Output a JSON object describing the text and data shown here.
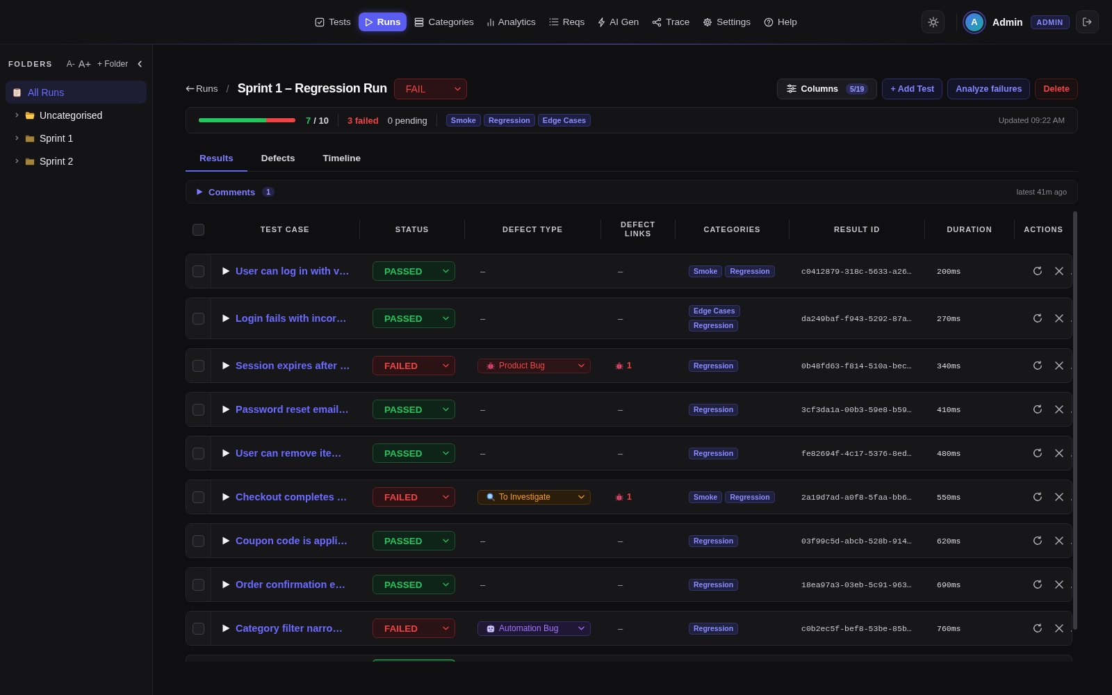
{
  "nav": {
    "items": [
      {
        "label": "Tests",
        "selected": false
      },
      {
        "label": "Runs",
        "selected": true
      },
      {
        "label": "Categories",
        "selected": false
      },
      {
        "label": "Analytics",
        "selected": false
      },
      {
        "label": "Reqs",
        "selected": false
      },
      {
        "label": "AI Gen",
        "selected": false
      },
      {
        "label": "Trace",
        "selected": false
      },
      {
        "label": "Settings",
        "selected": false
      },
      {
        "label": "Help",
        "selected": false
      }
    ]
  },
  "user": {
    "avatar_letter": "A",
    "name": "Admin",
    "role": "ADMIN"
  },
  "sidebar": {
    "title": "FOLDERS",
    "actions": [
      "A-",
      "A+",
      "+ Folder"
    ],
    "all_runs": {
      "label": "All Runs",
      "selected": true
    },
    "folders": [
      {
        "label": "Uncategorised",
        "kind": "uncategorised",
        "expanded": false,
        "selected": false
      },
      {
        "label": "Sprint 1",
        "kind": "folder",
        "expanded": false,
        "selected": false
      },
      {
        "label": "Sprint 2",
        "kind": "folder",
        "expanded": false,
        "selected": false
      }
    ]
  },
  "run": {
    "back_link": "Runs",
    "separator": "/",
    "title": "Sprint 1 – Regression Run",
    "result": {
      "label": "FAIL",
      "kind": "fail"
    },
    "buttons": [
      {
        "label": "Columns",
        "badge": "5/19",
        "kind": "menu"
      },
      {
        "label": "+ Add Test",
        "kind": "accent"
      },
      {
        "label": "Analyze failures",
        "kind": "accent"
      },
      {
        "label": "Delete",
        "kind": "danger"
      }
    ]
  },
  "summary": {
    "progress": {
      "level": 0.7
    },
    "passed": "7",
    "total": "/ 10",
    "failed": "3 failed",
    "pending": "0 pending",
    "tags": [
      "Smoke",
      "Regression",
      "Edge Cases"
    ],
    "updated": "Updated 09:22 AM"
  },
  "tabs": [
    {
      "label": "Results",
      "selected": true
    },
    {
      "label": "Defects",
      "selected": false
    },
    {
      "label": "Timeline",
      "selected": false
    }
  ],
  "comments": {
    "label": "Comments",
    "count": "1",
    "expanded": false,
    "latest": "latest 41m ago"
  },
  "table": {
    "select_all": {
      "checked": false
    },
    "columns": [
      "TEST CASE",
      "STATUS",
      "DEFECT TYPE",
      "DEFECT LINKS",
      "CATEGORIES",
      "RESULT ID",
      "DURATION",
      "ACTIONS"
    ],
    "rows": [
      {
        "checked": false,
        "expanded": false,
        "test_case": "User can log in with v…",
        "status": {
          "label": "PASSED",
          "kind": "passed"
        },
        "defect_type": {
          "kind": "none",
          "text": "–"
        },
        "defect_links": {
          "kind": "none",
          "text": "–"
        },
        "categories": [
          "Smoke",
          "Regression"
        ],
        "result_id": "c0412879-318c-5633-a26…",
        "duration": "200ms"
      },
      {
        "checked": false,
        "expanded": false,
        "test_case": "Login fails with incor…",
        "status": {
          "label": "PASSED",
          "kind": "passed"
        },
        "defect_type": {
          "kind": "none",
          "text": "–"
        },
        "defect_links": {
          "kind": "none",
          "text": "–"
        },
        "categories": [
          "Edge Cases",
          "Regression"
        ],
        "result_id": "da249baf-f943-5292-87a…",
        "duration": "270ms"
      },
      {
        "checked": false,
        "expanded": false,
        "test_case": "Session expires after …",
        "status": {
          "label": "FAILED",
          "kind": "failed"
        },
        "defect_type": {
          "kind": "product_bug",
          "label": "Product Bug"
        },
        "defect_links": {
          "kind": "linked",
          "count": "1"
        },
        "categories": [
          "Regression"
        ],
        "result_id": "0b48fd63-f814-510a-bec…",
        "duration": "340ms"
      },
      {
        "checked": false,
        "expanded": false,
        "test_case": "Password reset email…",
        "status": {
          "label": "PASSED",
          "kind": "passed"
        },
        "defect_type": {
          "kind": "none",
          "text": "–"
        },
        "defect_links": {
          "kind": "none",
          "text": "–"
        },
        "categories": [
          "Regression"
        ],
        "result_id": "3cf3da1a-00b3-59e8-b59…",
        "duration": "410ms"
      },
      {
        "checked": false,
        "expanded": false,
        "test_case": "User can remove ite…",
        "status": {
          "label": "PASSED",
          "kind": "passed"
        },
        "defect_type": {
          "kind": "none",
          "text": "–"
        },
        "defect_links": {
          "kind": "none",
          "text": "–"
        },
        "categories": [
          "Regression"
        ],
        "result_id": "fe82694f-4c17-5376-8ed…",
        "duration": "480ms"
      },
      {
        "checked": false,
        "expanded": false,
        "test_case": "Checkout completes …",
        "status": {
          "label": "FAILED",
          "kind": "failed"
        },
        "defect_type": {
          "kind": "to_investigate",
          "label": "To Investigate"
        },
        "defect_links": {
          "kind": "linked",
          "count": "1"
        },
        "categories": [
          "Smoke",
          "Regression"
        ],
        "result_id": "2a19d7ad-a0f8-5faa-bb6…",
        "duration": "550ms"
      },
      {
        "checked": false,
        "expanded": false,
        "test_case": "Coupon code is appli…",
        "status": {
          "label": "PASSED",
          "kind": "passed"
        },
        "defect_type": {
          "kind": "none",
          "text": "–"
        },
        "defect_links": {
          "kind": "none",
          "text": "–"
        },
        "categories": [
          "Regression"
        ],
        "result_id": "03f99c5d-abcb-528b-914…",
        "duration": "620ms"
      },
      {
        "checked": false,
        "expanded": false,
        "test_case": "Order confirmation e…",
        "status": {
          "label": "PASSED",
          "kind": "passed"
        },
        "defect_type": {
          "kind": "none",
          "text": "–"
        },
        "defect_links": {
          "kind": "none",
          "text": "–"
        },
        "categories": [
          "Regression"
        ],
        "result_id": "18ea97a3-03eb-5c91-963…",
        "duration": "690ms"
      },
      {
        "checked": false,
        "expanded": false,
        "test_case": "Category filter narro…",
        "status": {
          "label": "FAILED",
          "kind": "failed"
        },
        "defect_type": {
          "kind": "automation_bug",
          "label": "Automation Bug"
        },
        "defect_links": {
          "kind": "none",
          "text": "–"
        },
        "categories": [
          "Regression"
        ],
        "result_id": "c0b2ec5f-bef8-53be-85b…",
        "duration": "760ms"
      }
    ],
    "partial_row": {
      "status": {
        "kind": "passed"
      }
    }
  }
}
